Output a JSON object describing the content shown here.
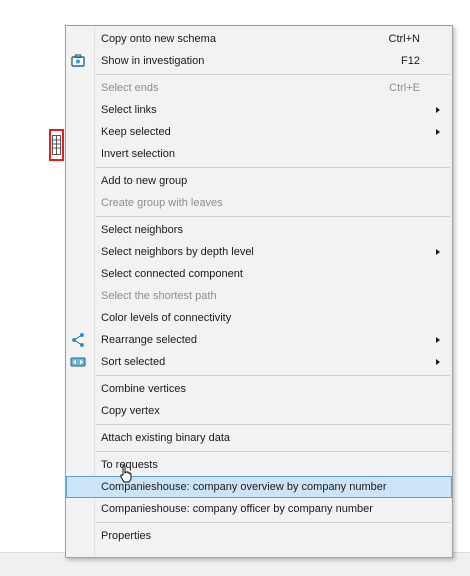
{
  "colors": {
    "menu_background": "#f2f2f2",
    "highlight": "#cce4f7",
    "highlight_border": "#5ea2d4",
    "node_border": "#e0201c",
    "disabled_text": "#8d8d8d"
  },
  "canvas": {
    "node_icon": "table-node-icon"
  },
  "menu": {
    "sections": [
      {
        "items": [
          {
            "label": "Copy onto new schema",
            "shortcut": "Ctrl+N",
            "enabled": true
          },
          {
            "label": "Show in investigation",
            "shortcut": "F12",
            "enabled": true,
            "icon": "investigation-icon"
          }
        ]
      },
      {
        "items": [
          {
            "label": "Select ends",
            "shortcut": "Ctrl+E",
            "enabled": false
          },
          {
            "label": "Select links",
            "enabled": true,
            "submenu": true
          },
          {
            "label": "Keep selected",
            "enabled": true,
            "submenu": true
          },
          {
            "label": "Invert selection",
            "enabled": true
          }
        ]
      },
      {
        "items": [
          {
            "label": "Add to new group",
            "enabled": true
          },
          {
            "label": "Create group with leaves",
            "enabled": false
          }
        ]
      },
      {
        "items": [
          {
            "label": "Select neighbors",
            "enabled": true
          },
          {
            "label": "Select neighbors by depth level",
            "enabled": true,
            "submenu": true
          },
          {
            "label": "Select connected component",
            "enabled": true
          },
          {
            "label": "Select the shortest path",
            "enabled": false
          },
          {
            "label": "Color levels of connectivity",
            "enabled": true
          },
          {
            "label": "Rearrange selected",
            "enabled": true,
            "submenu": true,
            "icon": "rearrange-icon"
          },
          {
            "label": "Sort selected",
            "enabled": true,
            "submenu": true,
            "icon": "sort-icon"
          }
        ]
      },
      {
        "items": [
          {
            "label": "Combine vertices",
            "enabled": true
          },
          {
            "label": "Copy vertex",
            "enabled": true
          }
        ]
      },
      {
        "items": [
          {
            "label": "Attach existing binary data",
            "enabled": true
          }
        ]
      },
      {
        "items": [
          {
            "label": "To requests",
            "enabled": true
          },
          {
            "label": "Companieshouse: company overview by company number",
            "enabled": true,
            "highlighted": true
          },
          {
            "label": "Companieshouse: company officer by company number",
            "enabled": true
          }
        ]
      },
      {
        "items": [
          {
            "label": "Properties",
            "enabled": true
          }
        ]
      }
    ]
  }
}
